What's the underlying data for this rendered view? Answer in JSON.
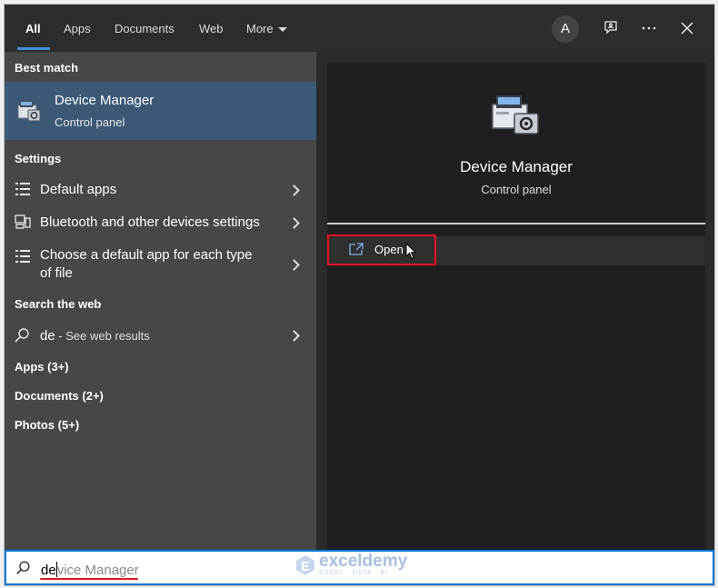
{
  "tabs": [
    {
      "label": "All",
      "active": true
    },
    {
      "label": "Apps",
      "active": false
    },
    {
      "label": "Documents",
      "active": false
    },
    {
      "label": "Web",
      "active": false
    },
    {
      "label": "More",
      "active": false
    }
  ],
  "header": {
    "avatar_letter": "A"
  },
  "best_match": {
    "heading": "Best match",
    "title": "Device Manager",
    "subtitle": "Control panel"
  },
  "settings": {
    "heading": "Settings",
    "items": [
      {
        "label": "Default apps"
      },
      {
        "label": "Bluetooth and other devices settings"
      },
      {
        "label_line1": "Choose a default app for each type",
        "label_line2": "of file"
      }
    ]
  },
  "web": {
    "heading": "Search the web",
    "query": "de",
    "suffix": " - See web results"
  },
  "categories": [
    {
      "label": "Apps (3+)"
    },
    {
      "label": "Documents (2+)"
    },
    {
      "label": "Photos (5+)"
    }
  ],
  "detail": {
    "title": "Device Manager",
    "subtitle": "Control panel",
    "open_label": "Open"
  },
  "search": {
    "typed": "de",
    "completion": "vice Manager"
  },
  "watermark": {
    "name": "exceldemy",
    "tagline": "EXCEL · DATA · BI"
  },
  "colors": {
    "accent": "#0078d7",
    "selected_row": "#3c5a78",
    "highlight_box": "#e81123",
    "underline": "#d81e1e"
  }
}
